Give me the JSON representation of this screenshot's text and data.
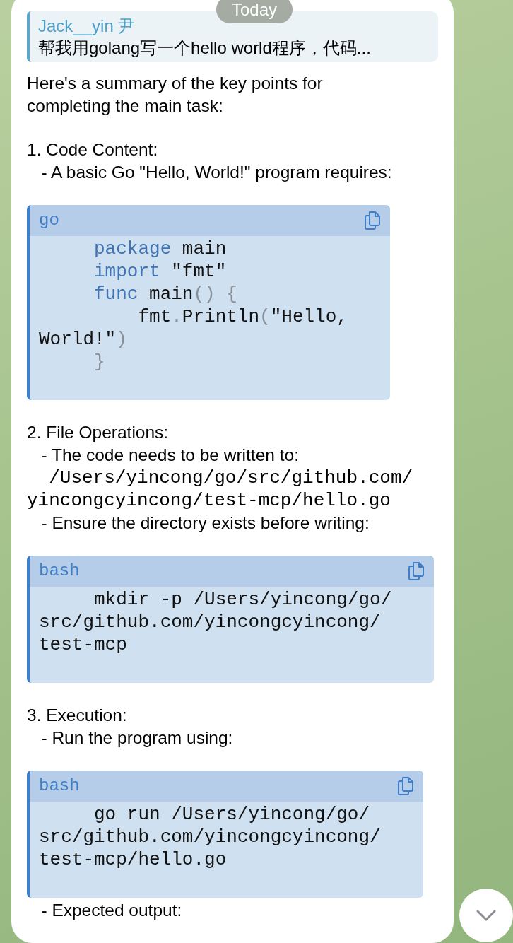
{
  "date_pill": "Today",
  "reply": {
    "author": "Jack__yin 尹",
    "text": "帮我用golang写一个hello world程序，代码..."
  },
  "content": [
    {
      "kind": "text",
      "lines": [
        {
          "kind": "prose",
          "text": "Here's a summary of the key points for"
        },
        {
          "kind": "prose",
          "text": "completing the main task:"
        }
      ]
    },
    {
      "kind": "text",
      "lines": [
        {
          "kind": "prose",
          "text": "1. Code Content:"
        },
        {
          "kind": "prose",
          "text": "   - A basic Go \"Hello, World!\" program requires:"
        }
      ]
    },
    {
      "kind": "code",
      "language": "go",
      "lines": [
        [
          {
            "t": "     package",
            "kind": "keyword"
          },
          {
            "t": " main",
            "kind": "plain"
          }
        ],
        [
          {
            "t": "     import",
            "kind": "keyword"
          },
          {
            "t": " \"fmt\"",
            "kind": "plain"
          }
        ],
        [
          {
            "t": "     func",
            "kind": "keyword"
          },
          {
            "t": " main",
            "kind": "plain"
          },
          {
            "t": "() {",
            "kind": "punct"
          }
        ],
        [
          {
            "t": "         fmt",
            "kind": "plain"
          },
          {
            "t": ".",
            "kind": "punct"
          },
          {
            "t": "Println",
            "kind": "plain"
          },
          {
            "t": "(",
            "kind": "punct"
          },
          {
            "t": "\"Hello,",
            "kind": "plain"
          }
        ],
        [
          {
            "t": "World!\"",
            "kind": "plain"
          },
          {
            "t": ")",
            "kind": "punct"
          }
        ],
        [
          {
            "t": "     }",
            "kind": "punct"
          }
        ]
      ]
    },
    {
      "kind": "text",
      "lines": [
        {
          "kind": "prose",
          "text": "2. File Operations:"
        },
        {
          "kind": "prose",
          "text": "   - The code needs to be written to:"
        },
        {
          "kind": "path",
          "text": "  /Users/yincong/go/src/github.com/"
        },
        {
          "kind": "path",
          "text": "yincongcyincong/test-mcp/hello.go"
        },
        {
          "kind": "prose",
          "text": "   - Ensure the directory exists before writing:"
        }
      ]
    },
    {
      "kind": "code",
      "language": "bash",
      "lines": [
        [
          {
            "t": "     mkdir -p /Users/yincong/go/",
            "kind": "plain"
          }
        ],
        [
          {
            "t": "src/github.com/yincongcyincong/",
            "kind": "plain"
          }
        ],
        [
          {
            "t": "test-mcp",
            "kind": "plain"
          }
        ]
      ]
    },
    {
      "kind": "text",
      "lines": [
        {
          "kind": "prose",
          "text": "3. Execution:"
        },
        {
          "kind": "prose",
          "text": "   - Run the program using:"
        }
      ]
    },
    {
      "kind": "code",
      "language": "bash",
      "lines": [
        [
          {
            "t": "     go run /Users/yincong/go/",
            "kind": "plain"
          }
        ],
        [
          {
            "t": "src/github.com/yincongcyincong/",
            "kind": "plain"
          }
        ],
        [
          {
            "t": "test-mcp/hello.go",
            "kind": "plain"
          }
        ]
      ]
    },
    {
      "kind": "text",
      "lines": [
        {
          "kind": "prose",
          "text": "   - Expected output:"
        }
      ]
    }
  ]
}
